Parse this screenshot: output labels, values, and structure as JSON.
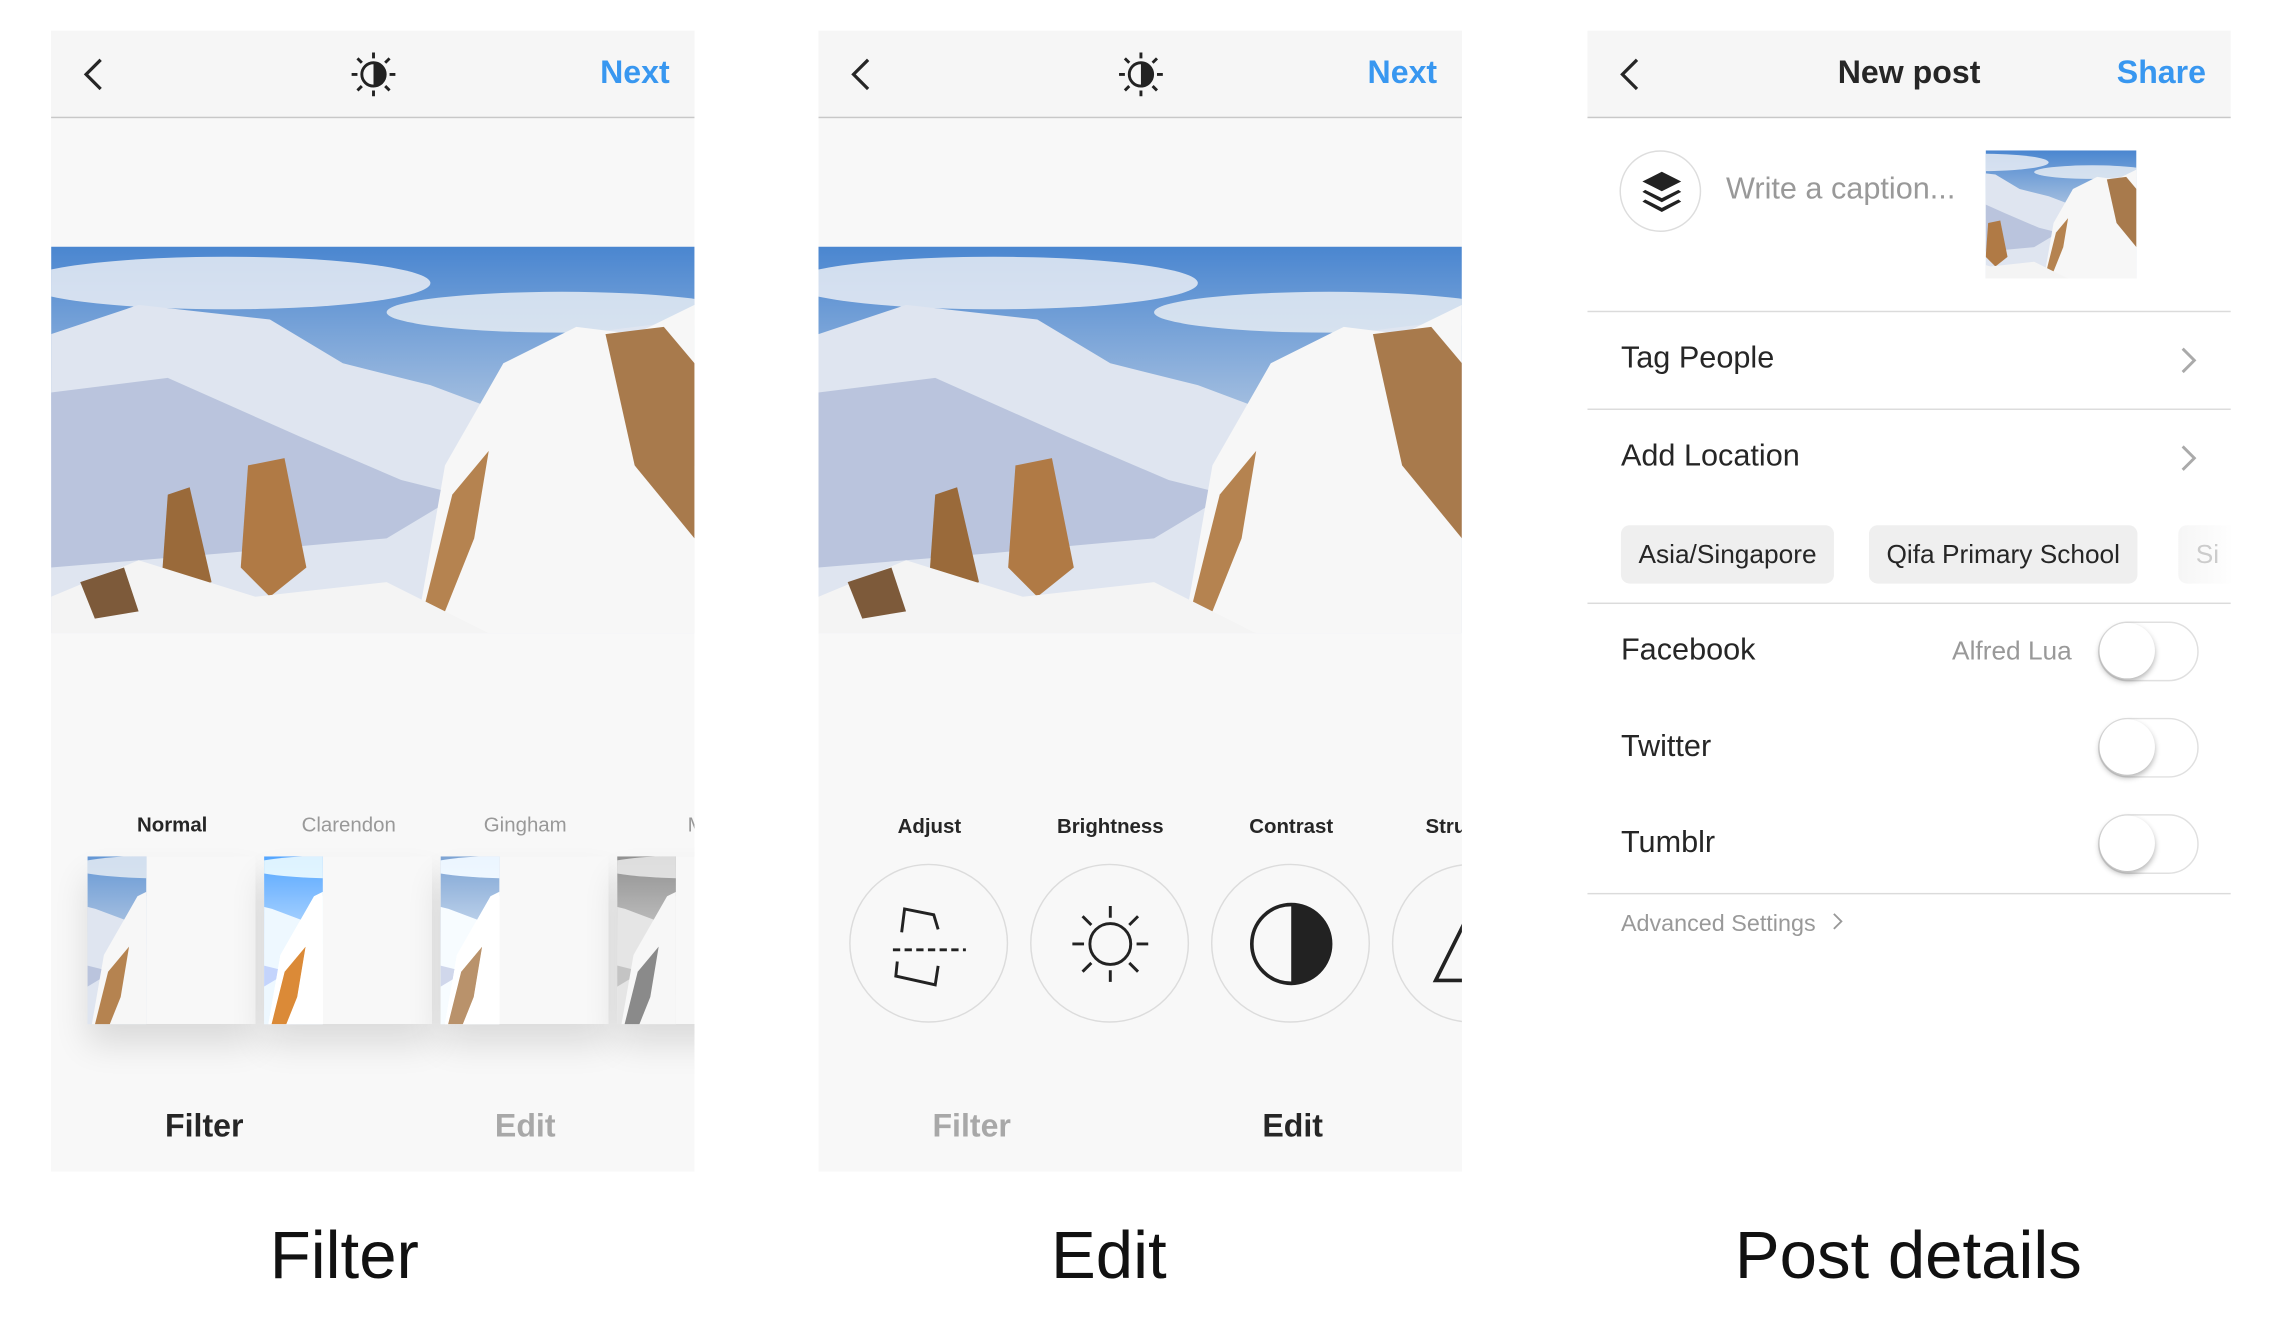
{
  "colors": {
    "accent": "#3897f0",
    "text": "#262626",
    "muted": "#a8a8a8"
  },
  "filter_screen": {
    "next_label": "Next",
    "filters": [
      {
        "label": "Normal",
        "selected": true
      },
      {
        "label": "Clarendon"
      },
      {
        "label": "Gingham"
      },
      {
        "label": "Mo"
      }
    ],
    "tabs": {
      "filter": "Filter",
      "edit": "Edit",
      "active": "filter"
    },
    "caption": "Filter"
  },
  "edit_screen": {
    "next_label": "Next",
    "tools": [
      {
        "label": "Adjust",
        "icon": "adjust-icon"
      },
      {
        "label": "Brightness",
        "icon": "brightness-icon"
      },
      {
        "label": "Contrast",
        "icon": "contrast-icon"
      },
      {
        "label": "Stru",
        "icon": "structure-icon"
      }
    ],
    "tabs": {
      "filter": "Filter",
      "edit": "Edit",
      "active": "edit"
    },
    "caption": "Edit"
  },
  "post_screen": {
    "title": "New post",
    "share_label": "Share",
    "caption_placeholder": "Write a caption...",
    "tag_people": "Tag People",
    "add_location": "Add Location",
    "location_chips": [
      "Asia/Singapore",
      "Qifa Primary School",
      "Si"
    ],
    "sharing": [
      {
        "label": "Facebook",
        "account": "Alfred Lua",
        "on": false
      },
      {
        "label": "Twitter",
        "on": false
      },
      {
        "label": "Tumblr",
        "on": false
      }
    ],
    "advanced_settings": "Advanced Settings",
    "caption": "Post details"
  }
}
